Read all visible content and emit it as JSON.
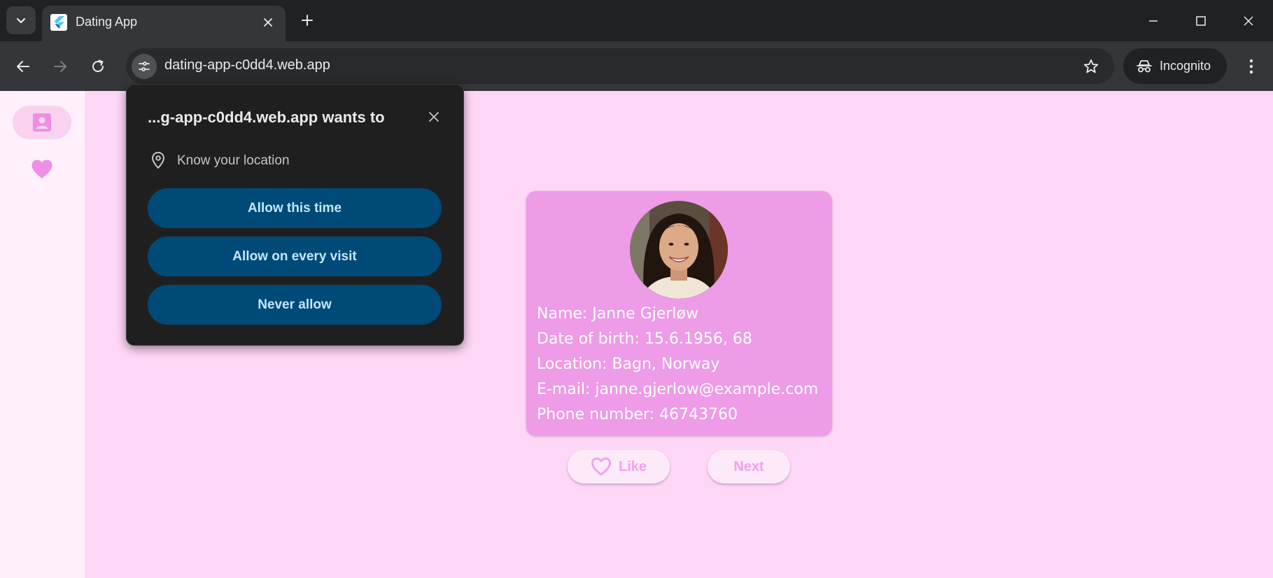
{
  "browser": {
    "tab_title": "Dating App",
    "url": "dating-app-c0dd4.web.app",
    "incognito_label": "Incognito"
  },
  "permission_prompt": {
    "title": "...g-app-c0dd4.web.app wants to",
    "request": "Know your location",
    "allow_once_label": "Allow this time",
    "allow_always_label": "Allow on every visit",
    "deny_label": "Never allow"
  },
  "profile": {
    "name_line": "Name: Janne Gjerløw",
    "dob_line": "Date of birth: 15.6.1956, 68",
    "location_line": "Location: Bagn, Norway",
    "email_line": "E-mail: janne.gjerlow@example.com",
    "phone_line": "Phone number: 46743760"
  },
  "actions": {
    "like_label": "Like",
    "next_label": "Next"
  },
  "colors": {
    "page_background": "#fed6f6",
    "card_background": "#ee9be8",
    "accent_pink": "#f3a0ea",
    "permission_button": "#004a77"
  },
  "icons": {
    "rail_profile": "person-card-icon",
    "rail_likes": "heart-icon",
    "location": "location-pin-icon"
  }
}
